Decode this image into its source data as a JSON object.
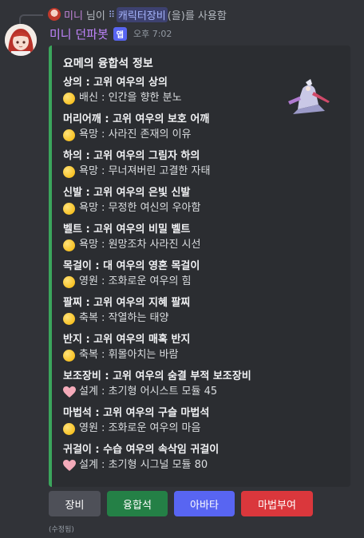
{
  "reply": {
    "user": "미니",
    "mid1": "님이",
    "command": "캐릭터장비",
    "suffix": "(을)를 사용함"
  },
  "message": {
    "bot_name": "미니 던파봇",
    "badge": "앱",
    "time": "오후 7:02",
    "edited": "(수정됨)"
  },
  "embed": {
    "accent_color": "#3ba55c",
    "title": "요메의 융합석 정보",
    "fields": [
      {
        "name": "상의 : 고위 여우의 상의",
        "value": "배신 : 인간을 향한 분노",
        "icon": "yellow-circle"
      },
      {
        "name": "머리어깨 : 고위 여우의 보호 어깨",
        "value": "욕망 : 사라진 존재의 이유",
        "icon": "yellow-circle"
      },
      {
        "name": "하의 : 고위 여우의 그림자 하의",
        "value": "욕망 : 무너져버린 고결한 자태",
        "icon": "yellow-circle"
      },
      {
        "name": "신발 : 고위 여우의 은빛 신발",
        "value": "욕망 : 무정한 여신의 우아함",
        "icon": "yellow-circle"
      },
      {
        "name": "벨트 : 고위 여우의 비밀 벨트",
        "value": "욕망 : 원망조차 사라진 시선",
        "icon": "yellow-circle"
      },
      {
        "name": "목걸이 : 대 여우의 영혼 목걸이",
        "value": "영원 : 조화로운 여우의 힘",
        "icon": "yellow-circle"
      },
      {
        "name": "팔찌 : 고위 여우의 지혜 팔찌",
        "value": "축복 : 작열하는 태양",
        "icon": "yellow-circle"
      },
      {
        "name": "반지 : 고위 여우의 매혹 반지",
        "value": "축복 : 휘몰아치는 바람",
        "icon": "yellow-circle"
      },
      {
        "name": "보조장비 : 고위 여우의 숨결 부적 보조장비",
        "value": "설계 : 초기형 어시스트 모듈 45",
        "icon": "pink-heart"
      },
      {
        "name": "마법석 : 고위 여우의 구슬 마법석",
        "value": "영원 : 조화로운 여우의 마음",
        "icon": "yellow-circle"
      },
      {
        "name": "귀걸이 : 수습 여우의 속삭임 귀걸이",
        "value": "설계 : 초기형 시그널 모듈 80",
        "icon": "pink-heart"
      }
    ]
  },
  "buttons": [
    {
      "label": "장비",
      "color": "#4e5058"
    },
    {
      "label": "융합석",
      "color": "#248046"
    },
    {
      "label": "아바타",
      "color": "#5865f2"
    },
    {
      "label": "마법부여",
      "color": "#da373c"
    }
  ]
}
